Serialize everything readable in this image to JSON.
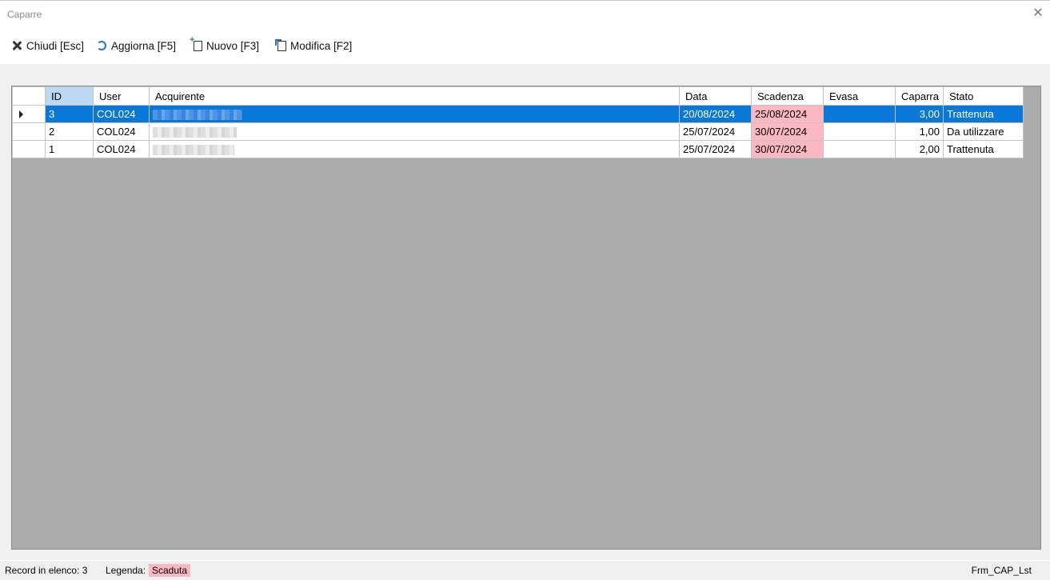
{
  "window": {
    "title": "Caparre"
  },
  "toolbar": {
    "close_label": "Chiudi [Esc]",
    "refresh_label": "Aggiorna [F5]",
    "new_label": "Nuovo [F3]",
    "edit_label": "Modifica [F2]"
  },
  "grid": {
    "columns": [
      "ID",
      "User",
      "Acquirente",
      "Data",
      "Scadenza",
      "Evasa",
      "Caparra",
      "Stato"
    ],
    "rows": [
      {
        "id": "3",
        "user": "COL024",
        "data": "20/08/2024",
        "scadenza": "25/08/2024",
        "evasa": "",
        "caparra": "3,00",
        "stato": "Trattenuta"
      },
      {
        "id": "2",
        "user": "COL024",
        "data": "25/07/2024",
        "scadenza": "30/07/2024",
        "evasa": "",
        "caparra": "1,00",
        "stato": "Da utilizzare"
      },
      {
        "id": "1",
        "user": "COL024",
        "data": "25/07/2024",
        "scadenza": "30/07/2024",
        "evasa": "",
        "caparra": "2,00",
        "stato": "Trattenuta"
      }
    ]
  },
  "status": {
    "record_count": "Record in elenco: 3",
    "legend_label": "Legenda:",
    "legend_expired": "Scaduta",
    "form_name": "Frm_CAP_Lst"
  },
  "colors": {
    "selection": "#0a78d8",
    "expired": "#fbb8c3",
    "grid_background": "#ababab"
  }
}
